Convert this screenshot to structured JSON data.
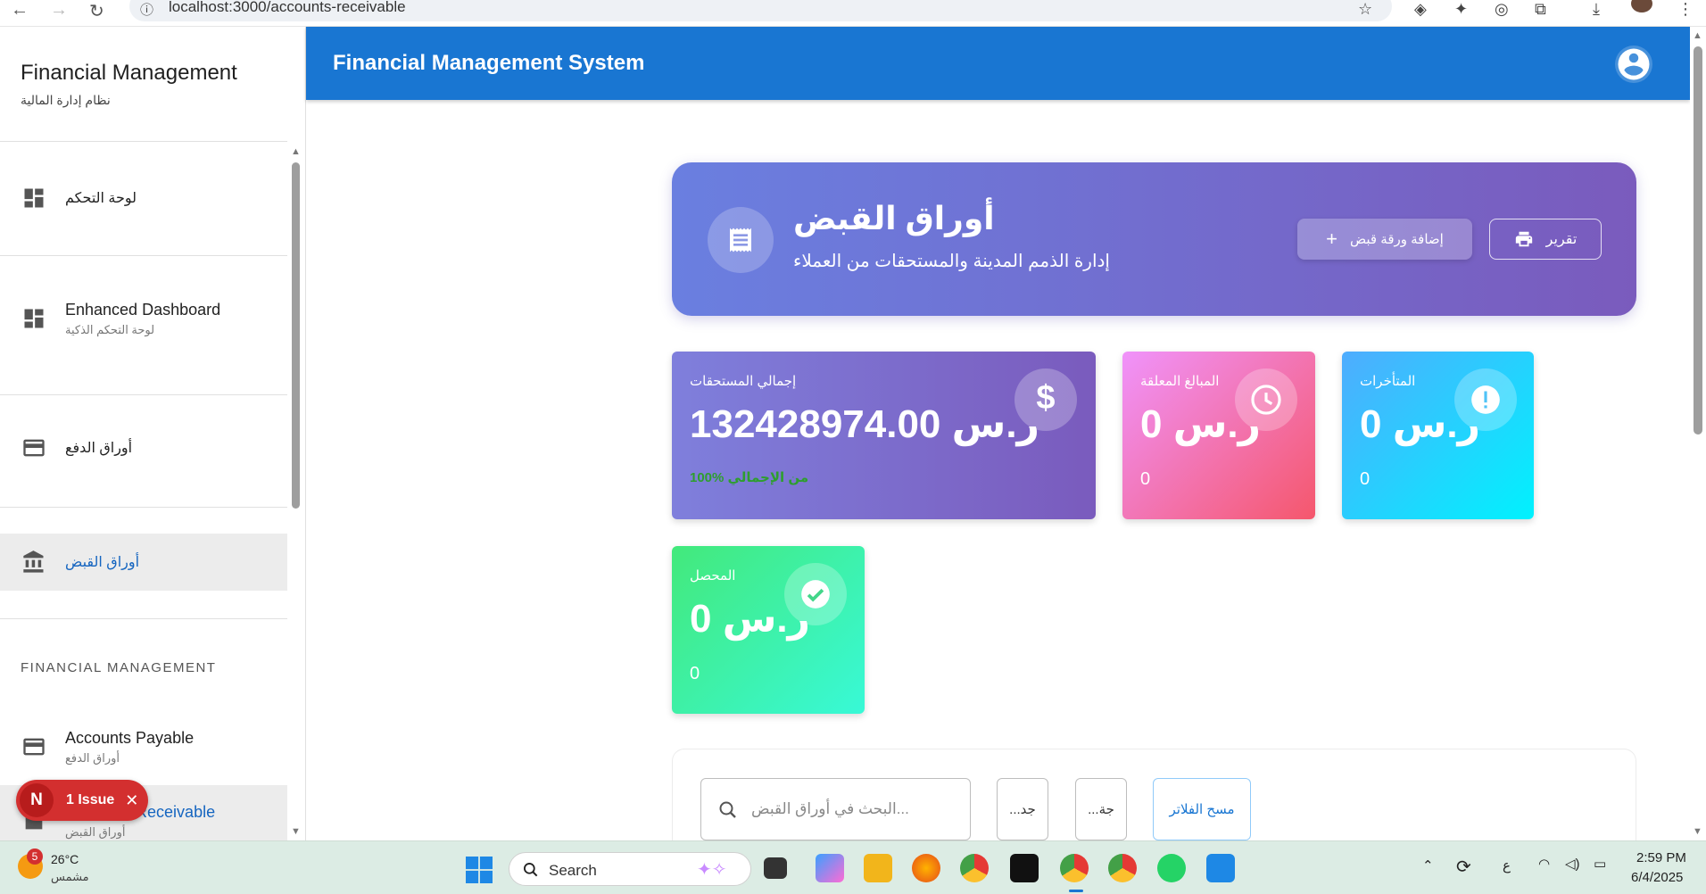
{
  "browser": {
    "url": "localhost:3000/accounts-receivable"
  },
  "sidebar": {
    "brand_title": "Financial Management",
    "brand_subtitle": "نظام إدارة المالية",
    "items": [
      {
        "label": "لوحة التحكم",
        "sub": ""
      },
      {
        "label": "Enhanced Dashboard",
        "sub": "لوحة التحكم الذكية"
      },
      {
        "label": "أوراق الدفع",
        "sub": ""
      },
      {
        "label": "أوراق القبض",
        "sub": ""
      }
    ],
    "section_label": "FINANCIAL MANAGEMENT",
    "section_items": [
      {
        "label": "Accounts Payable",
        "sub": "أوراق الدفع"
      },
      {
        "label": "Accounts Receivable",
        "sub": "أوراق القبض"
      }
    ]
  },
  "issue_badge": {
    "initial": "N",
    "text": "1 Issue",
    "close": "✕"
  },
  "appbar": {
    "title": "Financial Management System"
  },
  "hero": {
    "title": "أوراق القبض",
    "subtitle": "إدارة الذمم المدينة والمستحقات من العملاء",
    "add_button": "إضافة ورقة قبض",
    "report_button": "تقرير"
  },
  "stats": [
    {
      "label": "إجمالي المستحقات",
      "value": "132428974.00 ر.س",
      "note": "100% من الإجمالي",
      "color": "#7a5bbd",
      "icon": "dollar-icon"
    },
    {
      "label": "المبالغ المعلقة",
      "value": "0 ر.س",
      "note": "0",
      "color": "#f5576c",
      "icon": "clock-icon"
    },
    {
      "label": "المتأخرات",
      "value": "0 ر.س",
      "note": "0",
      "color": "#00f2fe",
      "icon": "alert-icon"
    },
    {
      "label": "المحصل",
      "value": "0 ر.س",
      "note": "0",
      "color": "#38f9d7",
      "icon": "check-icon"
    }
  ],
  "filters": {
    "search_placeholder": "البحث في أوراق القبض...",
    "filter_1": "...جد",
    "filter_2": "...جة",
    "clear_button": "مسح الفلاتر"
  },
  "taskbar": {
    "weather_badge": "5",
    "temperature": "26°C",
    "weather_desc": "مشمس",
    "search_label": "Search",
    "lang": "ع",
    "time": "2:59 PM",
    "date": "6/4/2025"
  }
}
